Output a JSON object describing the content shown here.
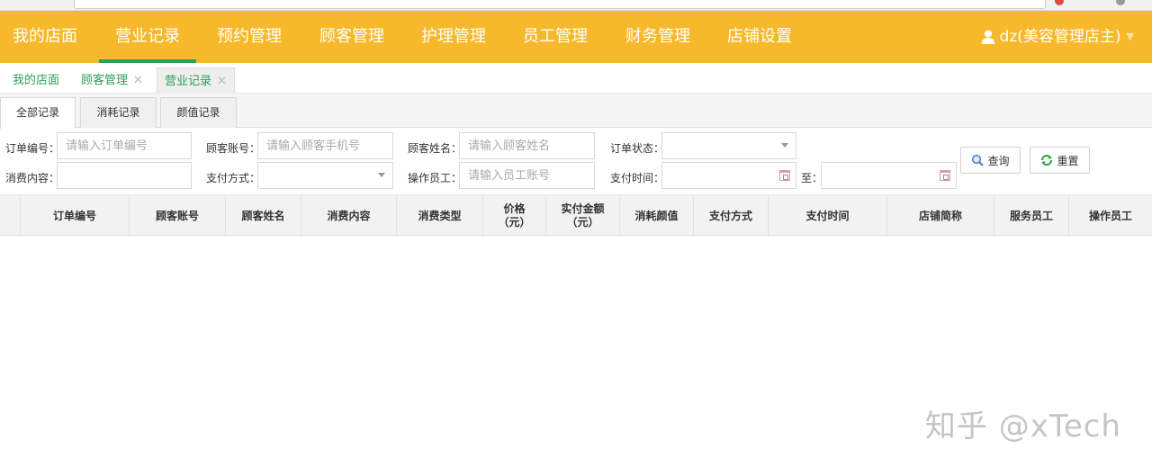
{
  "nav": {
    "items": [
      "我的店面",
      "营业记录",
      "预约管理",
      "顾客管理",
      "护理管理",
      "员工管理",
      "财务管理",
      "店铺设置"
    ],
    "active": "营业记录",
    "user": "dz(美容管理店主)"
  },
  "page_tabs": [
    {
      "label": "我的店面"
    },
    {
      "label": "顾客管理"
    },
    {
      "label": "营业记录"
    }
  ],
  "sub_tabs": [
    "全部记录",
    "消耗记录",
    "颜值记录"
  ],
  "filters": {
    "order_no": {
      "label": "订单编号：",
      "placeholder": "请输入订单编号"
    },
    "customer_account": {
      "label": "顾客账号：",
      "placeholder": "请输入顾客手机号"
    },
    "customer_name": {
      "label": "顾客姓名：",
      "placeholder": "请输入顾客姓名"
    },
    "order_status": {
      "label": "订单状态："
    },
    "content": {
      "label": "消费内容："
    },
    "pay_method": {
      "label": "支付方式："
    },
    "operator": {
      "label": "操作员工：",
      "placeholder": "请输入员工账号"
    },
    "pay_time": {
      "label": "支付时间：",
      "to_label": "至："
    }
  },
  "buttons": {
    "query": "查询",
    "reset": "重置"
  },
  "table": {
    "columns": [
      "订单编号",
      "顾客账号",
      "顾客姓名",
      "消费内容",
      "消费类型",
      "价格\n（元）",
      "实付金额\n（元）",
      "消耗颜值",
      "支付方式",
      "支付时间",
      "店铺简称",
      "服务员工",
      "操作员工"
    ]
  },
  "watermark": "知乎 @xTech",
  "colors": {
    "nav_bg": "#f7b92b",
    "accent_green": "#2e9e5b"
  }
}
